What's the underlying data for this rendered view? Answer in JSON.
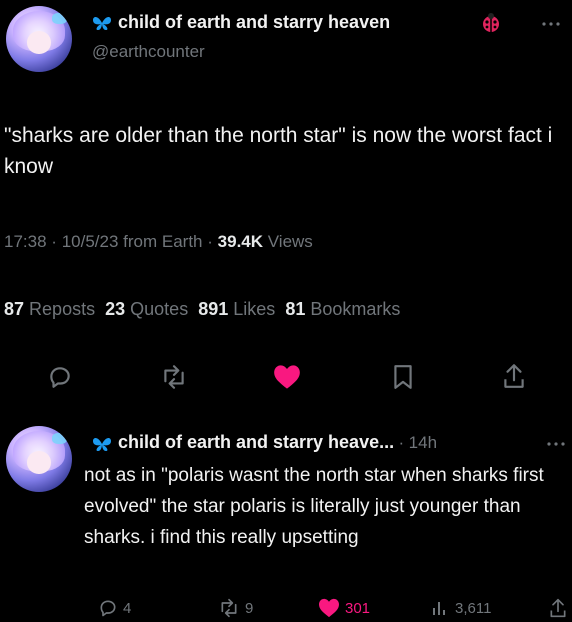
{
  "tweet": {
    "author_name": "child of earth and starry heaven",
    "author_handle": "@earthcounter",
    "text": "\"sharks are older than the north star\" is now the worst fact i know",
    "time": "17:38",
    "date": "10/5/23",
    "source": "from Earth",
    "views_count": "39.4K",
    "views_label": "Views",
    "reposts_count": "87",
    "reposts_label": "Reposts",
    "quotes_count": "23",
    "quotes_label": "Quotes",
    "likes_count": "891",
    "likes_label": "Likes",
    "bookmarks_count": "81",
    "bookmarks_label": "Bookmarks"
  },
  "reply": {
    "author_name": "child of earth and starry heave...",
    "age": "14h",
    "text": "not as in \"polaris wasnt the north star when sharks first evolved\" the star polaris is literally just younger than sharks. i find this really upsetting",
    "replies": "4",
    "reposts": "9",
    "likes": "301",
    "views": "3,611"
  },
  "icons": {
    "butterfly": "butterfly-icon",
    "bug": "ladybug-icon",
    "more": "more-icon",
    "reply": "reply-icon",
    "repost": "repost-icon",
    "like": "heart-icon",
    "bookmark": "bookmark-icon",
    "share": "share-icon",
    "views": "views-icon"
  },
  "colors": {
    "background": "#000000",
    "text": "#e7e9ea",
    "muted": "#71767b",
    "like": "#f91880",
    "butterfly": "#1d9bf0",
    "bug": "#e0245e"
  },
  "sep": "·"
}
